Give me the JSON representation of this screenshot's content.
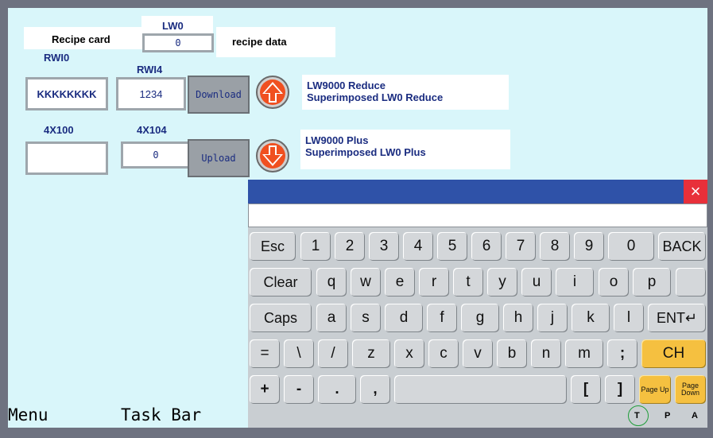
{
  "labels": {
    "lw0": "LW0",
    "recipe_card": "Recipe card",
    "recipe_data": "recipe data",
    "rwi0": "RWI0",
    "rwi4": "RWI4",
    "x4100": "4X100",
    "x4104": "4X104"
  },
  "fields": {
    "lw0_value": "0",
    "rwi0_value": "KKKKKKKK",
    "rwi4_value": "1234",
    "x4100_value": "",
    "x4104_value": "0"
  },
  "buttons": {
    "download": "Download",
    "upload": "Upload"
  },
  "notes": {
    "reduce_line1": "LW9000 Reduce",
    "reduce_line2": "Superimposed LW0 Reduce",
    "plus_line1": "LW9000 Plus",
    "plus_line2": "Superimposed LW0 Plus"
  },
  "keyboard": {
    "input_value": "",
    "close": "×",
    "row1": [
      "Esc",
      "1",
      "2",
      "3",
      "4",
      "5",
      "6",
      "7",
      "8",
      "9",
      "0",
      "BACK"
    ],
    "row2": [
      "Clear",
      "q",
      "w",
      "e",
      "r",
      "t",
      "y",
      "u",
      "i",
      "o",
      "p"
    ],
    "row3": [
      "Caps",
      "a",
      "s",
      "d",
      "f",
      "g",
      "h",
      "j",
      "k",
      "l",
      "ENT↵"
    ],
    "row4": [
      "=",
      "\\",
      "/",
      "z",
      "x",
      "c",
      "v",
      "b",
      "n",
      "m",
      ";",
      "CH"
    ],
    "row5": [
      "+",
      "-",
      ".",
      ",",
      "",
      "[",
      "]"
    ],
    "page_up": "Page Up",
    "page_down": "Page Down"
  },
  "taskbar": {
    "menu": "Menu",
    "task_bar": "Task Bar",
    "sys_t": "T",
    "sys_p": "P",
    "sys_a": "A"
  },
  "colors": {
    "background": "#d9f6fa",
    "titlebar": "#2f52a8",
    "close": "#e8303a",
    "accent_key": "#f5c040",
    "arrow": "#f05020"
  },
  "icons": [
    "arrow-up-icon",
    "arrow-down-icon",
    "close-icon"
  ]
}
